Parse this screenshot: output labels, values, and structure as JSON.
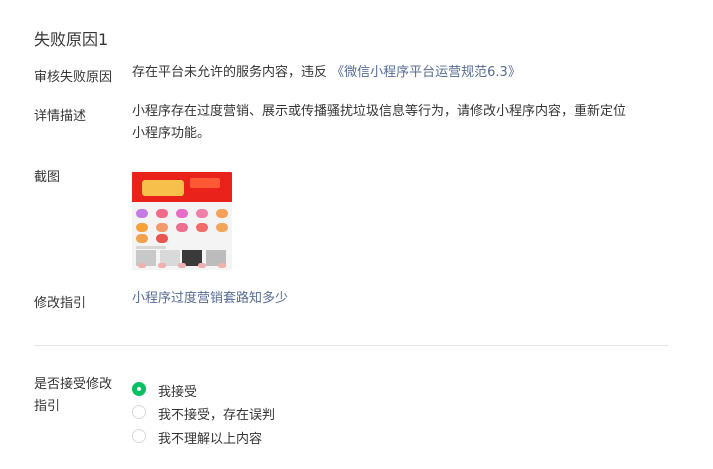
{
  "section": {
    "title": "失败原因1"
  },
  "reason": {
    "label": "审核失败原因",
    "text": "存在平台未允许的服务内容，违反",
    "link": "《微信小程序平台运营规范6.3》"
  },
  "detail": {
    "label": "详情描述",
    "line1": "小程序存在过度营销、展示或传播骚扰垃圾信息等行为，请修改小程序内容，重新定位",
    "line2": "小程序功能。"
  },
  "screenshot": {
    "label": "截图"
  },
  "guide": {
    "label": "修改指引",
    "link": "小程序过度营销套路知多少"
  },
  "accept": {
    "label_line1": "是否接受修改",
    "label_line2": "指引",
    "options": [
      {
        "label": "我接受",
        "selected": true
      },
      {
        "label": "我不接受，存在误判",
        "selected": false
      },
      {
        "label": "我不理解以上内容",
        "selected": false
      }
    ]
  },
  "colors": {
    "link": "#576b95",
    "radio_selected": "#07c160",
    "divider": "#e7e7e7"
  }
}
